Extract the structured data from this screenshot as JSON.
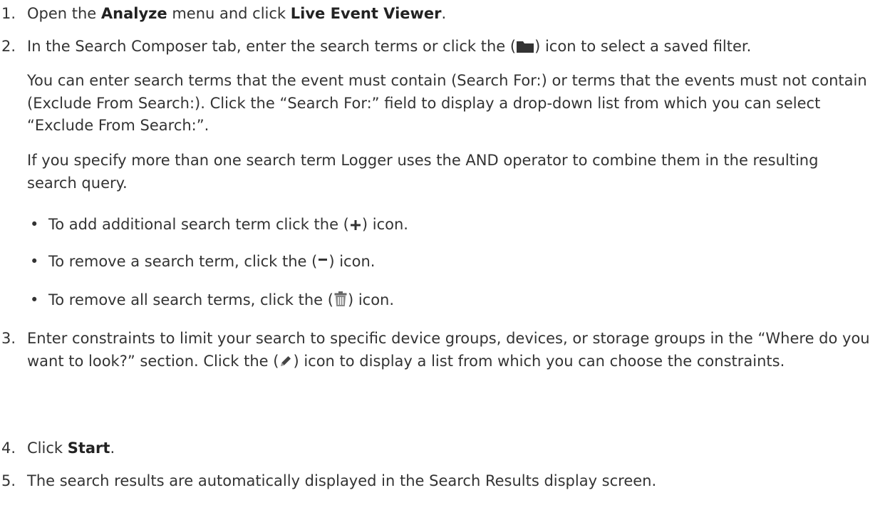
{
  "steps": [
    {
      "num": "1.",
      "pre": "Open the ",
      "bold1": "Analyze",
      "mid": " menu and click ",
      "bold2": "Live Event Viewer",
      "post": "."
    },
    {
      "num": "2.",
      "pre": "In the Search Composer tab, enter the search terms or click the (",
      "post": ") icon to select a saved filter.",
      "para1": "You can enter search terms that the event must contain (Search For:) or terms that the events must not contain (Exclude From Search:). Click the “Search For:” field to display a drop-down list from which you can select “Exclude From Search:”.",
      "para2": "If you specify more than one search term Logger uses the AND operator to combine them in the resulting search query.",
      "bullets": [
        {
          "pre": "To add additional search term click the (",
          "post": ") icon."
        },
        {
          "pre": "To remove a search term, click the (",
          "post": ") icon."
        },
        {
          "pre": "To remove all search terms, click the (",
          "post": ") icon."
        }
      ]
    },
    {
      "num": "3.",
      "pre": "Enter constraints to limit your search to specific device groups, devices, or storage groups in the “Where do you want to look?” section. Click the (",
      "post": ") icon to display a list from which you can choose the constraints."
    },
    {
      "num": "4.",
      "pre": "Click ",
      "bold1": "Start",
      "post": "."
    },
    {
      "num": "5.",
      "pre": "The search results are automatically displayed in the Search Results display screen."
    }
  ],
  "icons": {
    "folder": "folder-icon",
    "plus": "plus-icon",
    "minus": "minus-icon",
    "trash": "trash-icon",
    "pencil": "pencil-icon"
  }
}
